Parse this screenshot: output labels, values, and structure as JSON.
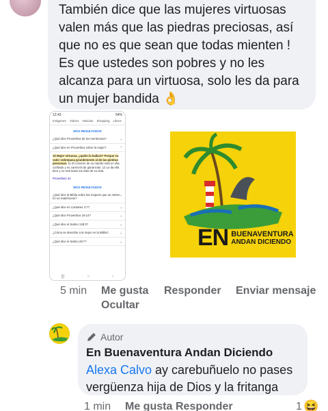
{
  "comment1": {
    "text": "También dice que las mujeres virtuosas valen más que las piedras preciosas, así que no es que sean que todas mienten ! Es que ustedes son pobres y no les alcanza para un virtuosa, solo les da para un mujer bandida",
    "emoji": "👌"
  },
  "screenshot": {
    "status_time": "12:43",
    "status_right": "54%",
    "tabs": [
      "Imágenes",
      "Videos",
      "Noticias",
      "Shopping",
      "Libros"
    ],
    "section1": "MÁS RESULTADOS",
    "q1": "¿Qué dice Proverbios de los mentirosos?",
    "q2": "¿Qué dice en Proverbios sobre la mujer?",
    "answer_bold": "10 Mujer virtuosa, ¿quién la hallará? Porque su valor sobrepasa grandemente al de las piedras preciosas.",
    "answer_rest": "11 El corazón de su marido está en ella confiado y no carecerá de ganancias. 12 Le da ella bien y no mal todos los días de su vida.",
    "link": "Proverbios 31",
    "section2": "MÁS RESULTADOS",
    "q3": "¿Qué dice la Biblia sobre las mujeres que se meten en un matrimonio?",
    "q4": "¿Qué dice en Cantares 4:7?",
    "q5": "¿Qué dice Proverbios 19:14?",
    "q6": "¿Qué dice el Salmo 128:3?",
    "q7": "¿Cómo se describe a la mujer en la Biblia?",
    "q8": "¿Qué dice el Salmo 28:7?"
  },
  "logo": {
    "big": "EN",
    "line1": "BUENAVENTURA",
    "line2": "ANDAN DICIENDO"
  },
  "actions1": {
    "time": "5 min",
    "like": "Me gusta",
    "hide": "Ocultar",
    "reply": "Responder",
    "message": "Enviar mensaje"
  },
  "reply": {
    "author_label": "Autor",
    "page_name": "En Buenaventura Andan Diciendo",
    "mention": "Alexa Calvo",
    "text": " ay carebuñuelo no pases vergüenza hija de Dios y la fritanga"
  },
  "actions2": {
    "time": "1 min",
    "like": "Me gusta",
    "reply": "Responder",
    "reaction_count": "1",
    "reaction_emoji": "😆"
  },
  "colors": {
    "bubble": "#eff1f4",
    "link": "#1877f2",
    "logo_bg": "#f5d20a"
  }
}
